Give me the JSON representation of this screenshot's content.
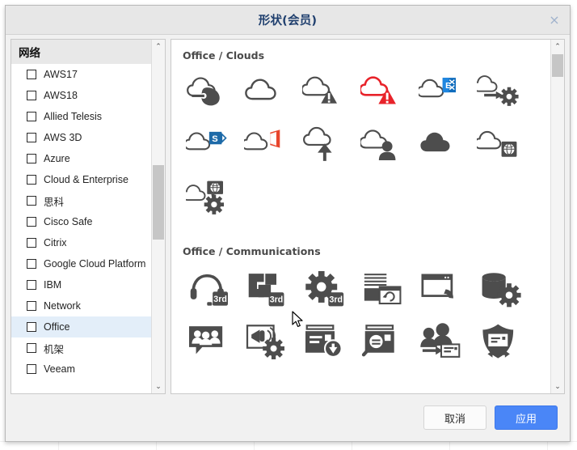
{
  "window": {
    "title": "形状(会员)",
    "close_label": "×"
  },
  "sidebar": {
    "group_header": "网络",
    "scroll": {
      "up_arrow": "⌃",
      "down_arrow": "⌄"
    },
    "items": [
      {
        "label": "AWS17",
        "checked": false,
        "selected": false
      },
      {
        "label": "AWS18",
        "checked": false,
        "selected": false
      },
      {
        "label": "Allied Telesis",
        "checked": false,
        "selected": false
      },
      {
        "label": "AWS 3D",
        "checked": false,
        "selected": false
      },
      {
        "label": "Azure",
        "checked": false,
        "selected": false
      },
      {
        "label": "Cloud & Enterprise",
        "checked": false,
        "selected": false
      },
      {
        "label": "思科",
        "checked": false,
        "selected": false
      },
      {
        "label": "Cisco Safe",
        "checked": false,
        "selected": false
      },
      {
        "label": "Citrix",
        "checked": false,
        "selected": false
      },
      {
        "label": "Google Cloud Platform",
        "checked": false,
        "selected": false
      },
      {
        "label": "IBM",
        "checked": false,
        "selected": false
      },
      {
        "label": "Network",
        "checked": false,
        "selected": false
      },
      {
        "label": "Office",
        "checked": false,
        "selected": true
      },
      {
        "label": "机架",
        "checked": false,
        "selected": false
      },
      {
        "label": "Veeam",
        "checked": false,
        "selected": false
      }
    ]
  },
  "palette": {
    "scroll": {
      "up_arrow": "⌃",
      "down_arrow": "⌄"
    },
    "sections": [
      {
        "title": "Office / Clouds",
        "icons": [
          {
            "name": "cloud-hybrid-icon",
            "glyph": "cloud-hybrid"
          },
          {
            "name": "cloud-outline-icon",
            "glyph": "cloud-outline"
          },
          {
            "name": "cloud-warning-icon",
            "glyph": "cloud-warning"
          },
          {
            "name": "cloud-alert-red-icon",
            "glyph": "cloud-alert-red"
          },
          {
            "name": "cloud-exchange-icon",
            "glyph": "cloud-exchange"
          },
          {
            "name": "cloud-to-gear-icon",
            "glyph": "cloud-to-gear"
          },
          {
            "name": "cloud-sharepoint-icon",
            "glyph": "cloud-sharepoint"
          },
          {
            "name": "cloud-office-icon",
            "glyph": "cloud-office"
          },
          {
            "name": "cloud-upload-icon",
            "glyph": "cloud-upload"
          },
          {
            "name": "cloud-user-icon",
            "glyph": "cloud-user"
          },
          {
            "name": "cloud-filled-icon",
            "glyph": "cloud-filled"
          },
          {
            "name": "cloud-globe-icon",
            "glyph": "cloud-globe"
          },
          {
            "name": "cloud-globe-gear-icon",
            "glyph": "cloud-globe-gear"
          }
        ]
      },
      {
        "title": "Office / Communications",
        "icons": [
          {
            "name": "headset-thirdparty-icon",
            "glyph": "headset-3rd"
          },
          {
            "name": "blocks-thirdparty-icon",
            "glyph": "blocks-3rd"
          },
          {
            "name": "gear-thirdparty-icon",
            "glyph": "gear-3rd"
          },
          {
            "name": "archive-sync-icon",
            "glyph": "archive-sync"
          },
          {
            "name": "window-phone-icon",
            "glyph": "window-phone"
          },
          {
            "name": "database-gear-icon",
            "glyph": "database-gear"
          },
          {
            "name": "group-chat-icon",
            "glyph": "group-chat"
          },
          {
            "name": "announcement-gear-icon",
            "glyph": "announce-gear"
          },
          {
            "name": "archive-download-icon",
            "glyph": "archive-download"
          },
          {
            "name": "archive-search-icon",
            "glyph": "archive-search"
          },
          {
            "name": "users-mail-transfer-icon",
            "glyph": "users-mail"
          },
          {
            "name": "shield-mail-icon",
            "glyph": "shield-mail"
          }
        ]
      }
    ]
  },
  "footer": {
    "cancel_label": "取消",
    "apply_label": "应用"
  },
  "colors": {
    "title": "#1f3f6e",
    "accent": "#4a86f7",
    "icon_dark": "#4d4d4d",
    "alert_red": "#e8232a",
    "selection": "#e3eef9",
    "sharepoint_blue": "#1d6aa8",
    "office_orange": "#e8452c",
    "exchange_blue": "#0f6cbd"
  }
}
